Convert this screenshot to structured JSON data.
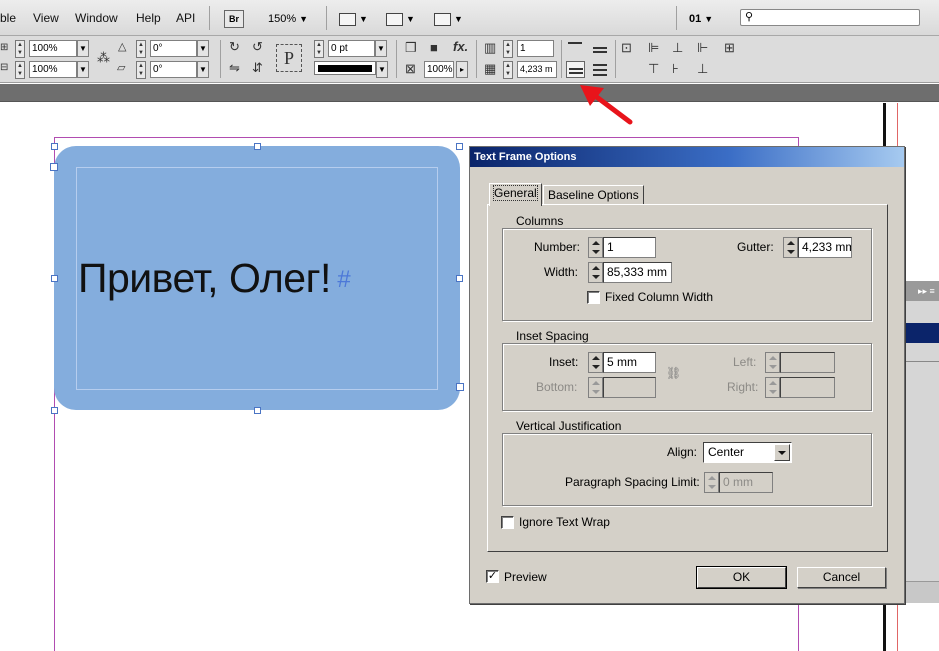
{
  "menu": {
    "items": [
      "ble",
      "View",
      "Window",
      "Help",
      "API"
    ],
    "bridge_badge": "Br",
    "zoom": "150%",
    "page_number": "01",
    "search_placeholder": ""
  },
  "control_panel": {
    "scale_x": "100%",
    "scale_y": "100%",
    "rotate_angle": "0°",
    "shear_angle": "0°",
    "stroke_weight": "0 pt",
    "opacity": "100%",
    "columns": "1",
    "gutter": "4,233 m",
    "paragraph_glyph": "P"
  },
  "canvas": {
    "frame_text": "Привет, Олег!",
    "end_marker": "#"
  },
  "dialog": {
    "title": "Text Frame Options",
    "tabs": [
      "General",
      "Baseline Options"
    ],
    "columns": {
      "title": "Columns",
      "number_label": "Number:",
      "number_value": "1",
      "gutter_label": "Gutter:",
      "gutter_value": "4,233 mm",
      "width_label": "Width:",
      "width_value": "85,333 mm",
      "fixed_width_label": "Fixed Column Width",
      "fixed_width_checked": false
    },
    "inset": {
      "title": "Inset Spacing",
      "inset_label": "Inset:",
      "inset_value": "5 mm",
      "bottom_label": "Bottom:",
      "left_label": "Left:",
      "right_label": "Right:"
    },
    "vertical": {
      "title": "Vertical Justification",
      "align_label": "Align:",
      "align_value": "Center",
      "spacing_label": "Paragraph Spacing Limit:",
      "spacing_value": "0 mm"
    },
    "ignore_wrap_label": "Ignore Text Wrap",
    "ignore_wrap_checked": false,
    "preview_label": "Preview",
    "preview_checked": true,
    "ok_label": "OK",
    "cancel_label": "Cancel"
  },
  "colors": {
    "frame_fill": "#84addd",
    "dialog_bg": "#d4d0c8",
    "title_bar": "#0a246a",
    "arrow": "#e8141b",
    "guide": "#b14cb1"
  }
}
